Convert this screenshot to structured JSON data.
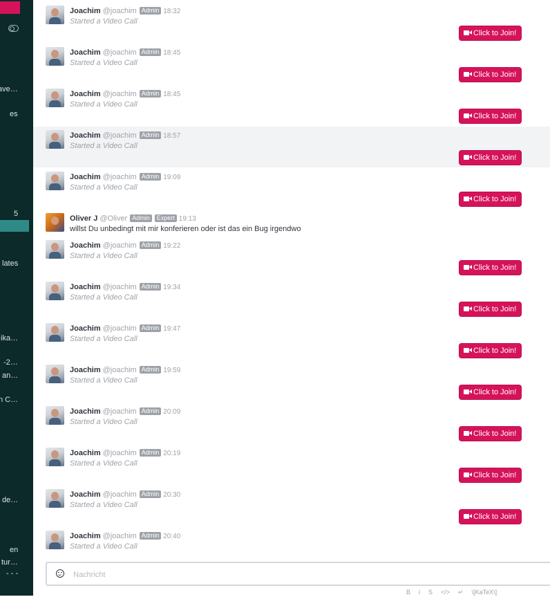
{
  "sidebar": {
    "items": [
      {
        "label": "ave…"
      },
      {
        "label": "es"
      },
      {
        "label": "5"
      },
      {
        "label": "lates"
      },
      {
        "label": "ika…"
      },
      {
        "label": "-2…"
      },
      {
        "label": "an…"
      },
      {
        "label": "n C…"
      },
      {
        "label": "de…"
      },
      {
        "label": "en"
      },
      {
        "label": "tur…"
      },
      {
        "label": "- - -"
      }
    ]
  },
  "join_label": "Click to Join!",
  "messages": [
    {
      "name": "Joachim",
      "handle": "@joachim",
      "badges": [
        "Admin"
      ],
      "time": "18:32",
      "text": "Started a Video Call"
    },
    {
      "name": "Joachim",
      "handle": "@joachim",
      "badges": [
        "Admin"
      ],
      "time": "18:45",
      "text": "Started a Video Call"
    },
    {
      "name": "Joachim",
      "handle": "@joachim",
      "badges": [
        "Admin"
      ],
      "time": "18:45",
      "text": "Started a Video Call"
    },
    {
      "name": "Joachim",
      "handle": "@joachim",
      "badges": [
        "Admin"
      ],
      "time": "18:57",
      "text": "Started a Video Call"
    },
    {
      "name": "Joachim",
      "handle": "@joachim",
      "badges": [
        "Admin"
      ],
      "time": "19:09",
      "text": "Started a Video Call"
    },
    {
      "name": "Oliver J",
      "handle": "@Oliver",
      "badges": [
        "Admin",
        "Expert"
      ],
      "time": "19:13",
      "text": "willst Du unbedingt mit mir konferieren oder ist das ein Bug irgendwo"
    },
    {
      "name": "Joachim",
      "handle": "@joachim",
      "badges": [
        "Admin"
      ],
      "time": "19:22",
      "text": "Started a Video Call"
    },
    {
      "name": "Joachim",
      "handle": "@joachim",
      "badges": [
        "Admin"
      ],
      "time": "19:34",
      "text": "Started a Video Call"
    },
    {
      "name": "Joachim",
      "handle": "@joachim",
      "badges": [
        "Admin"
      ],
      "time": "19:47",
      "text": "Started a Video Call"
    },
    {
      "name": "Joachim",
      "handle": "@joachim",
      "badges": [
        "Admin"
      ],
      "time": "19:59",
      "text": "Started a Video Call"
    },
    {
      "name": "Joachim",
      "handle": "@joachim",
      "badges": [
        "Admin"
      ],
      "time": "20:09",
      "text": "Started a Video Call"
    },
    {
      "name": "Joachim",
      "handle": "@joachim",
      "badges": [
        "Admin"
      ],
      "time": "20:19",
      "text": "Started a Video Call"
    },
    {
      "name": "Joachim",
      "handle": "@joachim",
      "badges": [
        "Admin"
      ],
      "time": "20:30",
      "text": "Started a Video Call"
    },
    {
      "name": "Joachim",
      "handle": "@joachim",
      "badges": [
        "Admin"
      ],
      "time": "20:40",
      "text": "Started a Video Call"
    }
  ],
  "composer": {
    "placeholder": "Nachricht"
  },
  "format_bar": [
    "B",
    "i",
    "S",
    "</>",
    "↵",
    "\\[KaTeX\\]"
  ],
  "colors": {
    "sidebar_bg": "#0c2a2a",
    "accent": "#d6135a",
    "active_item": "#2e8a86",
    "highlight_row": "#f2f3f5"
  }
}
